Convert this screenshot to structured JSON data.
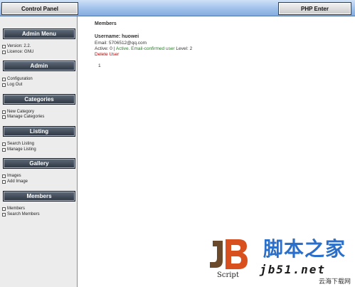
{
  "header": {
    "left_button": "Control Panel",
    "right_button": "PHP Enter"
  },
  "sidebar": {
    "sections": [
      {
        "title": "Admin Menu",
        "items": [
          "Version: 2.2.",
          "Licence: GNU"
        ]
      },
      {
        "title": "Admin",
        "items": [
          "Configuration",
          "Log Out"
        ]
      },
      {
        "title": "Categories",
        "items": [
          "New Category",
          "Manage Categories"
        ]
      },
      {
        "title": "Listing",
        "items": [
          "Search Listing",
          "Manage Listing"
        ]
      },
      {
        "title": "Gallery",
        "items": [
          "Images",
          "Add Image"
        ]
      },
      {
        "title": "Members",
        "items": [
          "Members",
          "Search Members"
        ]
      }
    ]
  },
  "main": {
    "title": "Members",
    "username_label": "Username: huowei",
    "email_line": "Email: 5706512@qq.com",
    "active_prefix": "Active: 0 | ",
    "active_status": "Active. Email-confirmed user",
    "level": " Level: 2",
    "delete_label": "Delete User",
    "page_number": "1"
  },
  "watermark": {
    "logo_letters": "JB",
    "script": "Script",
    "chinese_name": "脚本之家",
    "url": "jb51.net",
    "chinese_sub": "云海下载网"
  },
  "colors": {
    "header_blue": "#9fc1ea",
    "section_dark": "#2d3642",
    "delete_red": "#b30000",
    "status_green": "#2a7d2a",
    "logo_orange": "#d9501f",
    "logo_brown": "#6b4a2b"
  }
}
